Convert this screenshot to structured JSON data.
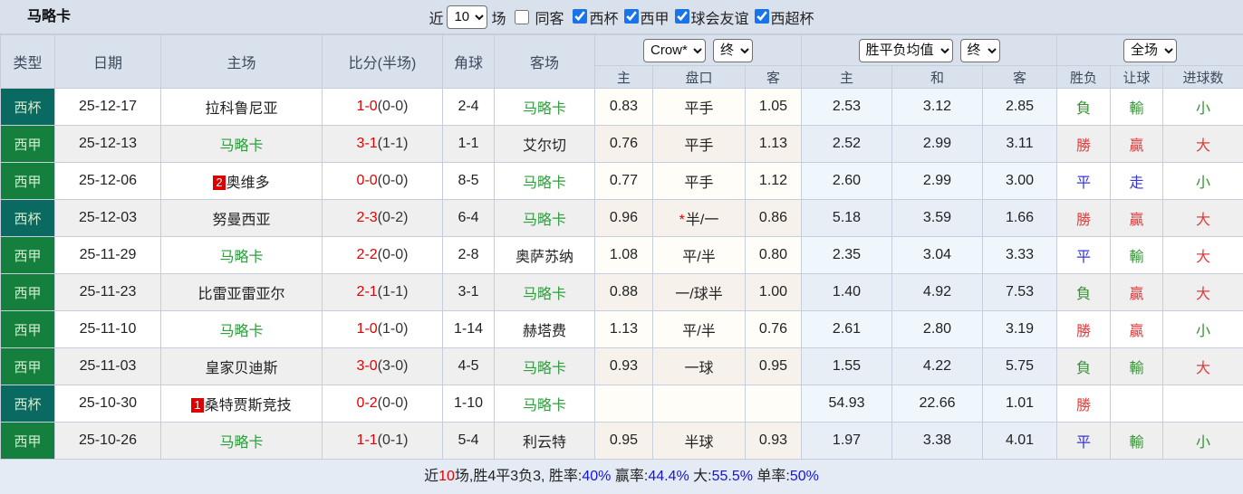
{
  "header_bar": {
    "title": "马略卡",
    "recent_label": "近",
    "recent_value": "10",
    "games_label": "场",
    "same_away": {
      "label": "同客",
      "checked": false
    },
    "filters": [
      {
        "label": "西杯",
        "checked": true
      },
      {
        "label": "西甲",
        "checked": true
      },
      {
        "label": "球会友谊",
        "checked": true
      },
      {
        "label": "西超杯",
        "checked": true
      }
    ]
  },
  "table": {
    "columns": [
      "类型",
      "日期",
      "主场",
      "比分(半场)",
      "角球",
      "客场"
    ],
    "selects": {
      "odds_company": "Crow*",
      "odds_company_time": "终",
      "europe_type": "胜平负均值",
      "europe_time": "终",
      "period": "全场"
    },
    "sub_headers": [
      "主",
      "盘口",
      "客",
      "主",
      "和",
      "客",
      "胜负",
      "让球",
      "进球数"
    ],
    "rows": [
      {
        "type": "西杯",
        "type_style": "cup",
        "date": "25-12-17",
        "home": "拉科鲁尼亚",
        "home_badge": "",
        "home_self": false,
        "score": "1-0",
        "half": "(0-0)",
        "corner": "2-4",
        "away": "马略卡",
        "away_self": true,
        "asia": {
          "home": "0.83",
          "handicap": "平手",
          "star": false,
          "away": "1.05"
        },
        "europe": {
          "home": "2.53",
          "draw": "3.12",
          "away": "2.85"
        },
        "results": [
          {
            "text": "負",
            "color": "green"
          },
          {
            "text": "輸",
            "color": "green"
          },
          {
            "text": "小",
            "color": "green"
          }
        ]
      },
      {
        "type": "西甲",
        "type_style": "league",
        "date": "25-12-13",
        "home": "马略卡",
        "home_badge": "",
        "home_self": true,
        "score": "3-1",
        "half": "(1-1)",
        "corner": "1-1",
        "away": "艾尔切",
        "away_self": false,
        "asia": {
          "home": "0.76",
          "handicap": "平手",
          "star": false,
          "away": "1.13"
        },
        "europe": {
          "home": "2.52",
          "draw": "2.99",
          "away": "3.11"
        },
        "results": [
          {
            "text": "勝",
            "color": "red"
          },
          {
            "text": "贏",
            "color": "red"
          },
          {
            "text": "大",
            "color": "red"
          }
        ]
      },
      {
        "type": "西甲",
        "type_style": "league",
        "date": "25-12-06",
        "home": "奥维多",
        "home_badge": "2",
        "home_self": false,
        "score": "0-0",
        "half": "(0-0)",
        "corner": "8-5",
        "away": "马略卡",
        "away_self": true,
        "asia": {
          "home": "0.77",
          "handicap": "平手",
          "star": false,
          "away": "1.12"
        },
        "europe": {
          "home": "2.60",
          "draw": "2.99",
          "away": "3.00"
        },
        "results": [
          {
            "text": "平",
            "color": "blue"
          },
          {
            "text": "走",
            "color": "blue"
          },
          {
            "text": "小",
            "color": "green"
          }
        ]
      },
      {
        "type": "西杯",
        "type_style": "cup",
        "date": "25-12-03",
        "home": "努曼西亚",
        "home_badge": "",
        "home_self": false,
        "score": "2-3",
        "half": "(0-2)",
        "corner": "6-4",
        "away": "马略卡",
        "away_self": true,
        "asia": {
          "home": "0.96",
          "handicap": "半/一",
          "star": true,
          "away": "0.86"
        },
        "europe": {
          "home": "5.18",
          "draw": "3.59",
          "away": "1.66"
        },
        "results": [
          {
            "text": "勝",
            "color": "red"
          },
          {
            "text": "贏",
            "color": "red"
          },
          {
            "text": "大",
            "color": "red"
          }
        ]
      },
      {
        "type": "西甲",
        "type_style": "league",
        "date": "25-11-29",
        "home": "马略卡",
        "home_badge": "",
        "home_self": true,
        "score": "2-2",
        "half": "(0-0)",
        "corner": "2-8",
        "away": "奥萨苏纳",
        "away_self": false,
        "asia": {
          "home": "1.08",
          "handicap": "平/半",
          "star": false,
          "away": "0.80"
        },
        "europe": {
          "home": "2.35",
          "draw": "3.04",
          "away": "3.33"
        },
        "results": [
          {
            "text": "平",
            "color": "blue"
          },
          {
            "text": "輸",
            "color": "green"
          },
          {
            "text": "大",
            "color": "red"
          }
        ]
      },
      {
        "type": "西甲",
        "type_style": "league",
        "date": "25-11-23",
        "home": "比雷亚雷亚尔",
        "home_badge": "",
        "home_self": false,
        "score": "2-1",
        "half": "(1-1)",
        "corner": "3-1",
        "away": "马略卡",
        "away_self": true,
        "asia": {
          "home": "0.88",
          "handicap": "一/球半",
          "star": false,
          "away": "1.00"
        },
        "europe": {
          "home": "1.40",
          "draw": "4.92",
          "away": "7.53"
        },
        "results": [
          {
            "text": "負",
            "color": "green"
          },
          {
            "text": "贏",
            "color": "red"
          },
          {
            "text": "大",
            "color": "red"
          }
        ]
      },
      {
        "type": "西甲",
        "type_style": "league",
        "date": "25-11-10",
        "home": "马略卡",
        "home_badge": "",
        "home_self": true,
        "score": "1-0",
        "half": "(1-0)",
        "corner": "1-14",
        "away": "赫塔费",
        "away_self": false,
        "asia": {
          "home": "1.13",
          "handicap": "平/半",
          "star": false,
          "away": "0.76"
        },
        "europe": {
          "home": "2.61",
          "draw": "2.80",
          "away": "3.19"
        },
        "results": [
          {
            "text": "勝",
            "color": "red"
          },
          {
            "text": "贏",
            "color": "red"
          },
          {
            "text": "小",
            "color": "green"
          }
        ]
      },
      {
        "type": "西甲",
        "type_style": "league",
        "date": "25-11-03",
        "home": "皇家贝迪斯",
        "home_badge": "",
        "home_self": false,
        "score": "3-0",
        "half": "(3-0)",
        "corner": "4-5",
        "away": "马略卡",
        "away_self": true,
        "asia": {
          "home": "0.93",
          "handicap": "一球",
          "star": false,
          "away": "0.95"
        },
        "europe": {
          "home": "1.55",
          "draw": "4.22",
          "away": "5.75"
        },
        "results": [
          {
            "text": "負",
            "color": "green"
          },
          {
            "text": "輸",
            "color": "green"
          },
          {
            "text": "大",
            "color": "red"
          }
        ]
      },
      {
        "type": "西杯",
        "type_style": "cup",
        "date": "25-10-30",
        "home": "桑特贾斯竞技",
        "home_badge": "1",
        "home_self": false,
        "score": "0-2",
        "half": "(0-0)",
        "corner": "1-10",
        "away": "马略卡",
        "away_self": true,
        "asia": {
          "home": "",
          "handicap": "",
          "star": false,
          "away": ""
        },
        "europe": {
          "home": "54.93",
          "draw": "22.66",
          "away": "1.01"
        },
        "results": [
          {
            "text": "勝",
            "color": "red"
          },
          {
            "text": "",
            "color": ""
          },
          {
            "text": "",
            "color": ""
          }
        ]
      },
      {
        "type": "西甲",
        "type_style": "league",
        "date": "25-10-26",
        "home": "马略卡",
        "home_badge": "",
        "home_self": true,
        "score": "1-1",
        "half": "(0-1)",
        "corner": "5-4",
        "away": "利云特",
        "away_self": false,
        "asia": {
          "home": "0.95",
          "handicap": "半球",
          "star": false,
          "away": "0.93"
        },
        "europe": {
          "home": "1.97",
          "draw": "3.38",
          "away": "4.01"
        },
        "results": [
          {
            "text": "平",
            "color": "blue"
          },
          {
            "text": "輸",
            "color": "green"
          },
          {
            "text": "小",
            "color": "green"
          }
        ]
      }
    ]
  },
  "footer": {
    "segments": [
      {
        "text": "近",
        "color": "dark"
      },
      {
        "text": "10",
        "color": "red"
      },
      {
        "text": "场,胜4平3负3, 胜率:",
        "color": "dark"
      },
      {
        "text": "40%",
        "color": "blue"
      },
      {
        "text": " 赢率:",
        "color": "dark"
      },
      {
        "text": "44.4%",
        "color": "blue"
      },
      {
        "text": " 大:",
        "color": "dark"
      },
      {
        "text": "55.5%",
        "color": "blue"
      },
      {
        "text": " 单率:",
        "color": "dark"
      },
      {
        "text": "50%",
        "color": "blue"
      }
    ]
  },
  "colors": {
    "cup_badge": "#0a6a62",
    "league_badge": "#15803d",
    "self_team_green": "#2e9e3e",
    "score_red": "#e60000",
    "win_red": "#e23b3b",
    "lose_green": "#359135",
    "draw_blue": "#3434e0",
    "link_blue": "#1414e0",
    "header_bg": "#d9e1ed"
  }
}
